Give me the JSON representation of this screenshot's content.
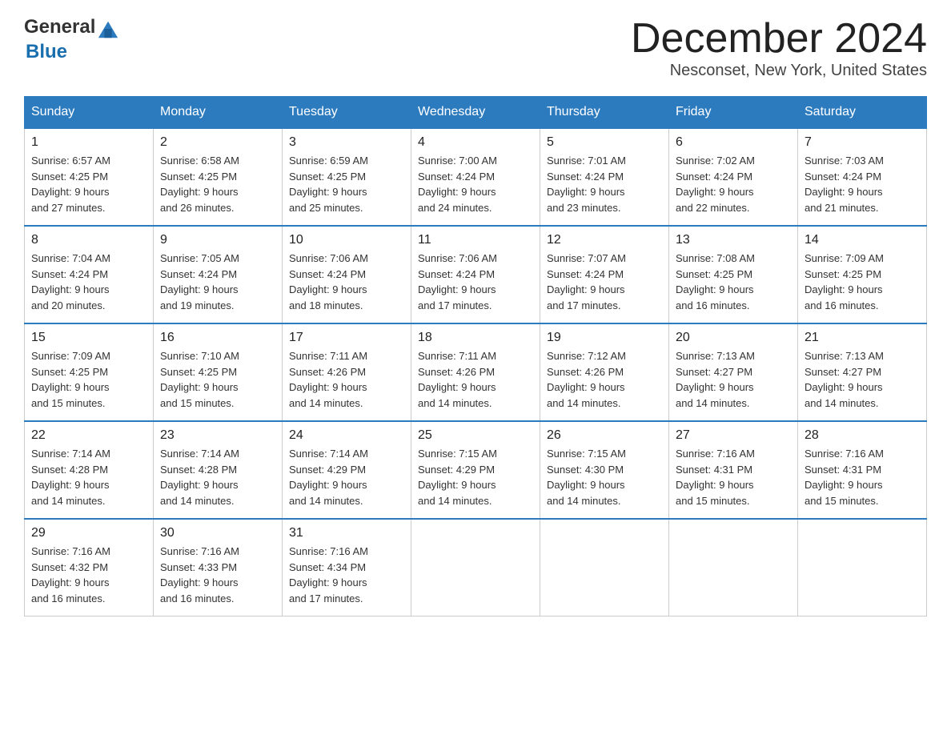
{
  "header": {
    "logo_general": "General",
    "logo_blue": "Blue",
    "month_title": "December 2024",
    "location": "Nesconset, New York, United States"
  },
  "days_of_week": [
    "Sunday",
    "Monday",
    "Tuesday",
    "Wednesday",
    "Thursday",
    "Friday",
    "Saturday"
  ],
  "weeks": [
    [
      {
        "day": "1",
        "sunrise": "6:57 AM",
        "sunset": "4:25 PM",
        "daylight": "9 hours and 27 minutes."
      },
      {
        "day": "2",
        "sunrise": "6:58 AM",
        "sunset": "4:25 PM",
        "daylight": "9 hours and 26 minutes."
      },
      {
        "day": "3",
        "sunrise": "6:59 AM",
        "sunset": "4:25 PM",
        "daylight": "9 hours and 25 minutes."
      },
      {
        "day": "4",
        "sunrise": "7:00 AM",
        "sunset": "4:24 PM",
        "daylight": "9 hours and 24 minutes."
      },
      {
        "day": "5",
        "sunrise": "7:01 AM",
        "sunset": "4:24 PM",
        "daylight": "9 hours and 23 minutes."
      },
      {
        "day": "6",
        "sunrise": "7:02 AM",
        "sunset": "4:24 PM",
        "daylight": "9 hours and 22 minutes."
      },
      {
        "day": "7",
        "sunrise": "7:03 AM",
        "sunset": "4:24 PM",
        "daylight": "9 hours and 21 minutes."
      }
    ],
    [
      {
        "day": "8",
        "sunrise": "7:04 AM",
        "sunset": "4:24 PM",
        "daylight": "9 hours and 20 minutes."
      },
      {
        "day": "9",
        "sunrise": "7:05 AM",
        "sunset": "4:24 PM",
        "daylight": "9 hours and 19 minutes."
      },
      {
        "day": "10",
        "sunrise": "7:06 AM",
        "sunset": "4:24 PM",
        "daylight": "9 hours and 18 minutes."
      },
      {
        "day": "11",
        "sunrise": "7:06 AM",
        "sunset": "4:24 PM",
        "daylight": "9 hours and 17 minutes."
      },
      {
        "day": "12",
        "sunrise": "7:07 AM",
        "sunset": "4:24 PM",
        "daylight": "9 hours and 17 minutes."
      },
      {
        "day": "13",
        "sunrise": "7:08 AM",
        "sunset": "4:25 PM",
        "daylight": "9 hours and 16 minutes."
      },
      {
        "day": "14",
        "sunrise": "7:09 AM",
        "sunset": "4:25 PM",
        "daylight": "9 hours and 16 minutes."
      }
    ],
    [
      {
        "day": "15",
        "sunrise": "7:09 AM",
        "sunset": "4:25 PM",
        "daylight": "9 hours and 15 minutes."
      },
      {
        "day": "16",
        "sunrise": "7:10 AM",
        "sunset": "4:25 PM",
        "daylight": "9 hours and 15 minutes."
      },
      {
        "day": "17",
        "sunrise": "7:11 AM",
        "sunset": "4:26 PM",
        "daylight": "9 hours and 14 minutes."
      },
      {
        "day": "18",
        "sunrise": "7:11 AM",
        "sunset": "4:26 PM",
        "daylight": "9 hours and 14 minutes."
      },
      {
        "day": "19",
        "sunrise": "7:12 AM",
        "sunset": "4:26 PM",
        "daylight": "9 hours and 14 minutes."
      },
      {
        "day": "20",
        "sunrise": "7:13 AM",
        "sunset": "4:27 PM",
        "daylight": "9 hours and 14 minutes."
      },
      {
        "day": "21",
        "sunrise": "7:13 AM",
        "sunset": "4:27 PM",
        "daylight": "9 hours and 14 minutes."
      }
    ],
    [
      {
        "day": "22",
        "sunrise": "7:14 AM",
        "sunset": "4:28 PM",
        "daylight": "9 hours and 14 minutes."
      },
      {
        "day": "23",
        "sunrise": "7:14 AM",
        "sunset": "4:28 PM",
        "daylight": "9 hours and 14 minutes."
      },
      {
        "day": "24",
        "sunrise": "7:14 AM",
        "sunset": "4:29 PM",
        "daylight": "9 hours and 14 minutes."
      },
      {
        "day": "25",
        "sunrise": "7:15 AM",
        "sunset": "4:29 PM",
        "daylight": "9 hours and 14 minutes."
      },
      {
        "day": "26",
        "sunrise": "7:15 AM",
        "sunset": "4:30 PM",
        "daylight": "9 hours and 14 minutes."
      },
      {
        "day": "27",
        "sunrise": "7:16 AM",
        "sunset": "4:31 PM",
        "daylight": "9 hours and 15 minutes."
      },
      {
        "day": "28",
        "sunrise": "7:16 AM",
        "sunset": "4:31 PM",
        "daylight": "9 hours and 15 minutes."
      }
    ],
    [
      {
        "day": "29",
        "sunrise": "7:16 AM",
        "sunset": "4:32 PM",
        "daylight": "9 hours and 16 minutes."
      },
      {
        "day": "30",
        "sunrise": "7:16 AM",
        "sunset": "4:33 PM",
        "daylight": "9 hours and 16 minutes."
      },
      {
        "day": "31",
        "sunrise": "7:16 AM",
        "sunset": "4:34 PM",
        "daylight": "9 hours and 17 minutes."
      },
      null,
      null,
      null,
      null
    ]
  ],
  "labels": {
    "sunrise": "Sunrise:",
    "sunset": "Sunset:",
    "daylight": "Daylight:"
  }
}
